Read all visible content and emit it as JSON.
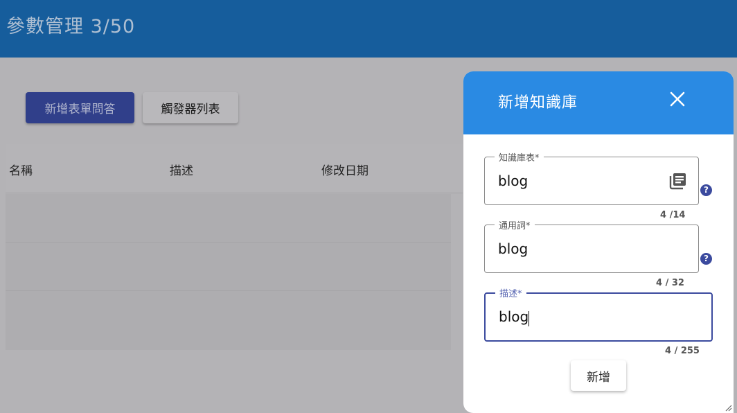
{
  "header": {
    "title": "參數管理 3/50"
  },
  "toolbar": {
    "add_form_qa_label": "新增表單問答",
    "trigger_list_label": "觸發器列表"
  },
  "table": {
    "columns": [
      "名稱",
      "描述",
      "修改日期"
    ]
  },
  "dialog": {
    "title": "新增知識庫",
    "fields": {
      "knowledge_table": {
        "label": "知識庫表*",
        "value": "blog",
        "counter": "4 /14"
      },
      "common_word": {
        "label": "通用詞*",
        "value": "blog",
        "counter": "4 / 32"
      },
      "description": {
        "label": "描述*",
        "value": "blog",
        "counter": "4 / 255"
      }
    },
    "submit_label": "新增"
  },
  "icons": {
    "close": "close-icon",
    "library": "library-books-icon",
    "help": "help-circle-icon",
    "resize": "resize-handle-icon"
  },
  "colors": {
    "appbar": "#165d9c",
    "primary": "#303f8a",
    "dialog_header": "#2a8ae3",
    "focus": "#3b4a9e"
  }
}
